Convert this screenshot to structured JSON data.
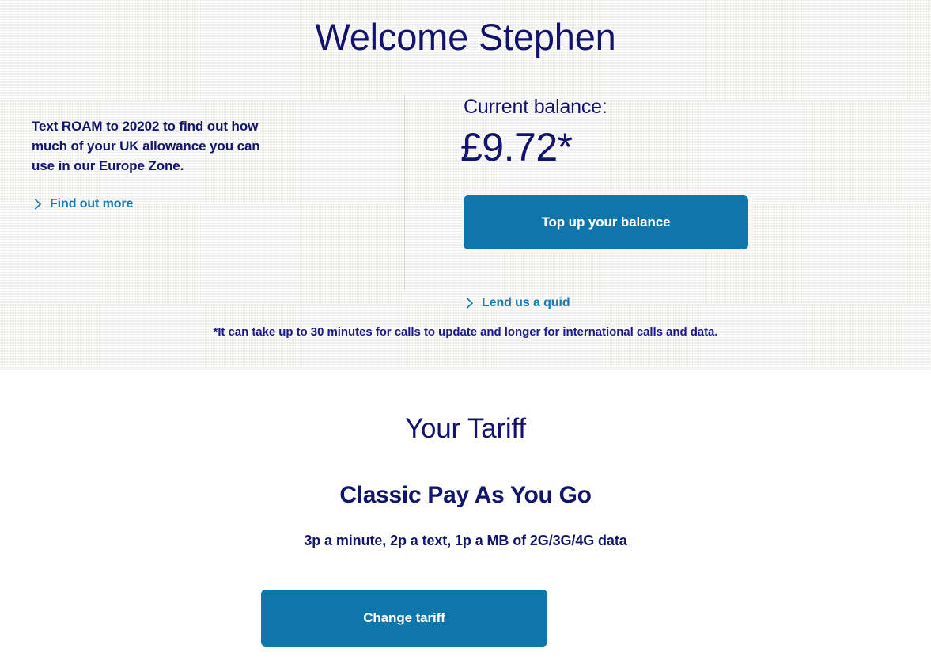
{
  "account_panel": {
    "welcome_title": "Welcome Stephen",
    "roam": {
      "text": "Text ROAM to 20202 to find out how much of your UK allowance you can use in our Europe Zone.",
      "link_label": "Find out more",
      "link_icon": "chevron-right-icon"
    },
    "balance": {
      "label": "Current balance:",
      "amount": "£9.72*",
      "topup_label": "Top up your balance",
      "lend_label": "Lend us a quid",
      "lend_icon": "chevron-right-icon"
    },
    "footnote": "*It can take up to 30 minutes for calls to update and longer for international calls and data."
  },
  "tariff_section": {
    "title": "Your Tariff",
    "name": "Classic Pay As You Go",
    "rates": "3p a minute, 2p a text, 1p a MB of 2G/3G/4G data",
    "change_label": "Change tariff"
  },
  "colors": {
    "navy": "#13136e",
    "link_blue": "#1479b5",
    "button_blue": "#0f76ac",
    "panel_gray": "#f3f2f1",
    "divider_gray": "#d8d6d4"
  }
}
